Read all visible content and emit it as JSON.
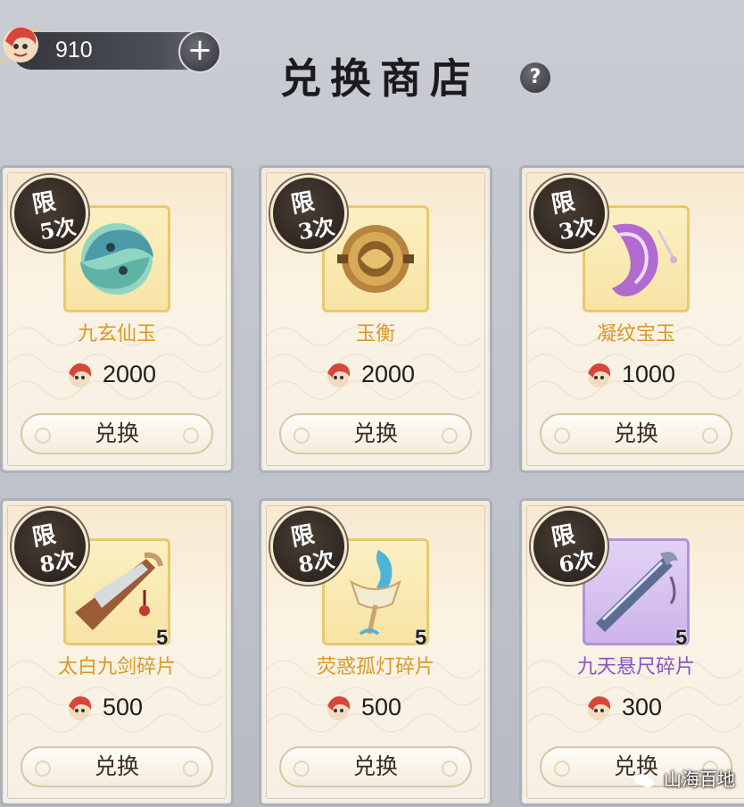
{
  "header": {
    "title": "兑换商店",
    "currency_amount": "910",
    "add_label": "+",
    "help_label": "?"
  },
  "shop_items": [
    {
      "limit_top": "限",
      "limit_bottom": "5次",
      "name": "九玄仙玉",
      "price": "2000",
      "action": "兑换",
      "icon": "jade-fish-icon",
      "stack": ""
    },
    {
      "limit_top": "限",
      "limit_bottom": "3次",
      "name": "玉衡",
      "price": "2000",
      "action": "兑换",
      "icon": "bronze-disc-icon",
      "stack": ""
    },
    {
      "limit_top": "限",
      "limit_bottom": "3次",
      "name": "凝纹宝玉",
      "price": "1000",
      "action": "兑换",
      "icon": "purple-pendant-icon",
      "stack": ""
    },
    {
      "limit_top": "限",
      "limit_bottom": "8次",
      "name": "太白九剑碎片",
      "price": "500",
      "action": "兑换",
      "icon": "sword-fragment-icon",
      "stack": "5"
    },
    {
      "limit_top": "限",
      "limit_bottom": "8次",
      "name": "荧惑孤灯碎片",
      "price": "500",
      "action": "兑换",
      "icon": "lantern-fragment-icon",
      "stack": "5"
    },
    {
      "limit_top": "限",
      "limit_bottom": "6次",
      "name": "九天悬尺碎片",
      "price": "300",
      "action": "兑换",
      "icon": "ruler-fragment-icon",
      "stack": "5"
    }
  ],
  "watermark": "山海百地",
  "colors": {
    "gold_name": "#d89a28",
    "purple_name": "#8a56c4",
    "card_bg": "#f8e9cf"
  }
}
